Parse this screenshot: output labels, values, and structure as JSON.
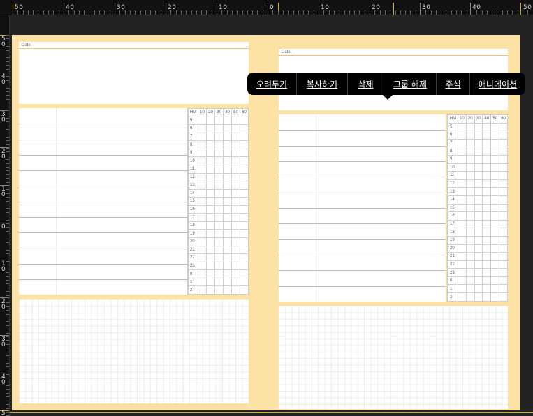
{
  "ruler": {
    "top_labels": [
      "50",
      "40",
      "30",
      "20",
      "10",
      "0",
      "10",
      "20",
      "30",
      "40",
      "50"
    ],
    "left_labels": [
      "5",
      "0",
      "4",
      "0",
      "3",
      "0",
      "2",
      "0",
      "1",
      "0",
      "0",
      "1",
      "0",
      "2",
      "0",
      "3",
      "0",
      "4",
      "0",
      "5"
    ]
  },
  "left_page": {
    "date_label": "Date."
  },
  "right_page": {
    "date_label": "Date."
  },
  "timetable": {
    "header": [
      "HM",
      "10",
      "20",
      "30",
      "40",
      "50",
      "60"
    ],
    "hours": [
      "5",
      "6",
      "7",
      "8",
      "9",
      "10",
      "11",
      "12",
      "13",
      "14",
      "15",
      "16",
      "17",
      "18",
      "19",
      "20",
      "21",
      "22",
      "23",
      "0",
      "1",
      "2"
    ]
  },
  "context_menu": {
    "items": [
      "오려두기",
      "복사하기",
      "삭제",
      "그룹 해제",
      "주석",
      "애니메이션"
    ]
  },
  "colors": {
    "canvas_bg": "#fde2a6",
    "menu_bg": "#000000",
    "ruler_mark": "#d4b300"
  }
}
